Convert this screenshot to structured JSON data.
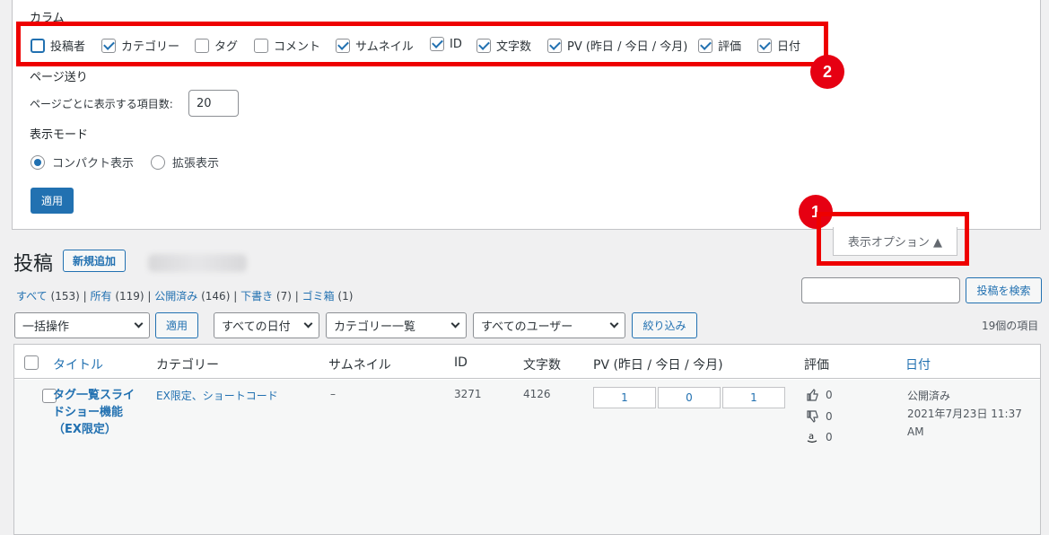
{
  "screen_options": {
    "columns_label": "カラム",
    "columns": [
      {
        "label": "投稿者",
        "checked": false
      },
      {
        "label": "カテゴリー",
        "checked": true
      },
      {
        "label": "タグ",
        "checked": false
      },
      {
        "label": "コメント",
        "checked": false
      },
      {
        "label": "サムネイル",
        "checked": true
      },
      {
        "label": "ID",
        "checked": true
      },
      {
        "label": "文字数",
        "checked": true
      },
      {
        "label": "PV (昨日 / 今日 / 今月)",
        "checked": true
      },
      {
        "label": "評価",
        "checked": true
      },
      {
        "label": "日付",
        "checked": true
      }
    ],
    "pagination_label": "ページ送り",
    "per_page_label": "ページごとに表示する項目数:",
    "per_page_value": "20",
    "view_mode_label": "表示モード",
    "view_modes": [
      "コンパクト表示",
      "拡張表示"
    ],
    "apply_label": "適用"
  },
  "annotations": {
    "badge1": "1",
    "badge2": "2"
  },
  "screen_options_toggle": "表示オプション ▲",
  "page": {
    "title": "投稿",
    "add_new": "新規追加",
    "filters": [
      {
        "label": "すべて",
        "count": "(153)"
      },
      {
        "label": "所有",
        "count": "(119)"
      },
      {
        "label": "公開済み",
        "count": "(146)"
      },
      {
        "label": "下書き",
        "count": "(7)"
      },
      {
        "label": "ゴミ箱",
        "count": "(1)"
      }
    ],
    "search_button": "投稿を検索",
    "search_value": ""
  },
  "tablenav": {
    "bulk_action": "一括操作",
    "apply": "適用",
    "date_filter": "すべての日付",
    "category_filter": "カテゴリー一覧",
    "user_filter": "すべてのユーザー",
    "filter_button": "絞り込み",
    "item_count": "19個の項目"
  },
  "table": {
    "headers": {
      "title": "タイトル",
      "category": "カテゴリー",
      "thumbnail": "サムネイル",
      "id": "ID",
      "chars": "文字数",
      "pv": "PV (昨日 / 今日 / 今月)",
      "rating": "評価",
      "date": "日付"
    },
    "rows": [
      {
        "title": "タグ一覧スライドショー機能（EX限定）",
        "category": "EX限定、ショートコード",
        "thumbnail": "–",
        "id": "3271",
        "chars": "4126",
        "pv": [
          "1",
          "0",
          "1"
        ],
        "likes": "0",
        "dislikes": "0",
        "amazon": "0",
        "status": "公開済み",
        "date": "2021年7月23日 11:37 AM"
      }
    ]
  },
  "colors": {
    "accent": "#2271b1",
    "annotation_red": "#ee0000"
  }
}
